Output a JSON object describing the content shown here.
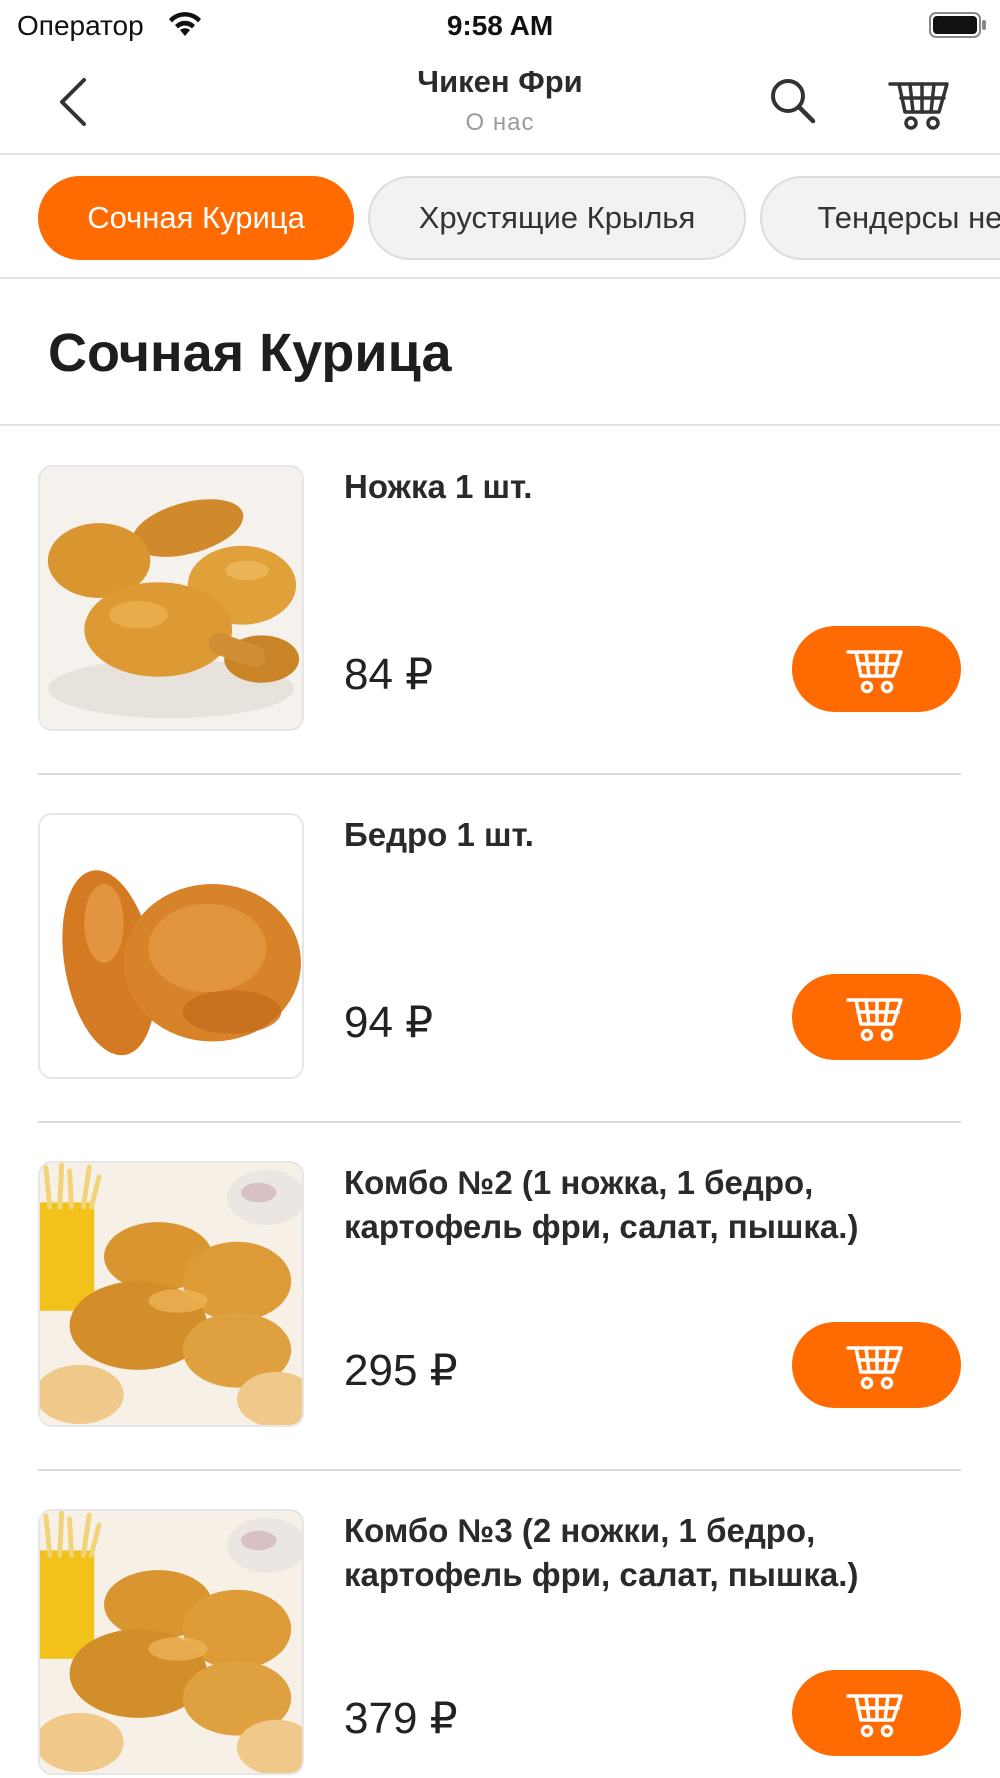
{
  "status_bar": {
    "carrier": "Оператор",
    "time": "9:58 AM"
  },
  "header": {
    "title": "Чикен Фри",
    "subtitle": "О нас",
    "icons": [
      "chevron-left-icon",
      "search-icon",
      "cart-icon"
    ]
  },
  "categories": [
    {
      "label": "Сочная Курица",
      "active": true
    },
    {
      "label": "Хрустящие Крылья",
      "active": false
    },
    {
      "label": "Тендерсы не",
      "active": false
    }
  ],
  "section": {
    "title": "Сочная Курица"
  },
  "products": [
    {
      "name": "Ножка 1 шт.",
      "price": "84 ₽",
      "image": "chicken-drumsticks"
    },
    {
      "name": "Бедро 1 шт.",
      "price": "94 ₽",
      "image": "chicken-thigh"
    },
    {
      "name": "Комбо №2 (1 ножка, 1 бедро, картофель фри, салат, пышка.)",
      "price": "295 ₽",
      "image": "combo-platter"
    },
    {
      "name": "Комбо №3 (2 ножки, 1 бедро, картофель фри, салат, пышка.)",
      "price": "379 ₽",
      "image": "combo-platter"
    }
  ],
  "colors": {
    "accent": "#ff6b00",
    "divider": "#e2e2e2",
    "subtitle": "#9a9a9a"
  }
}
